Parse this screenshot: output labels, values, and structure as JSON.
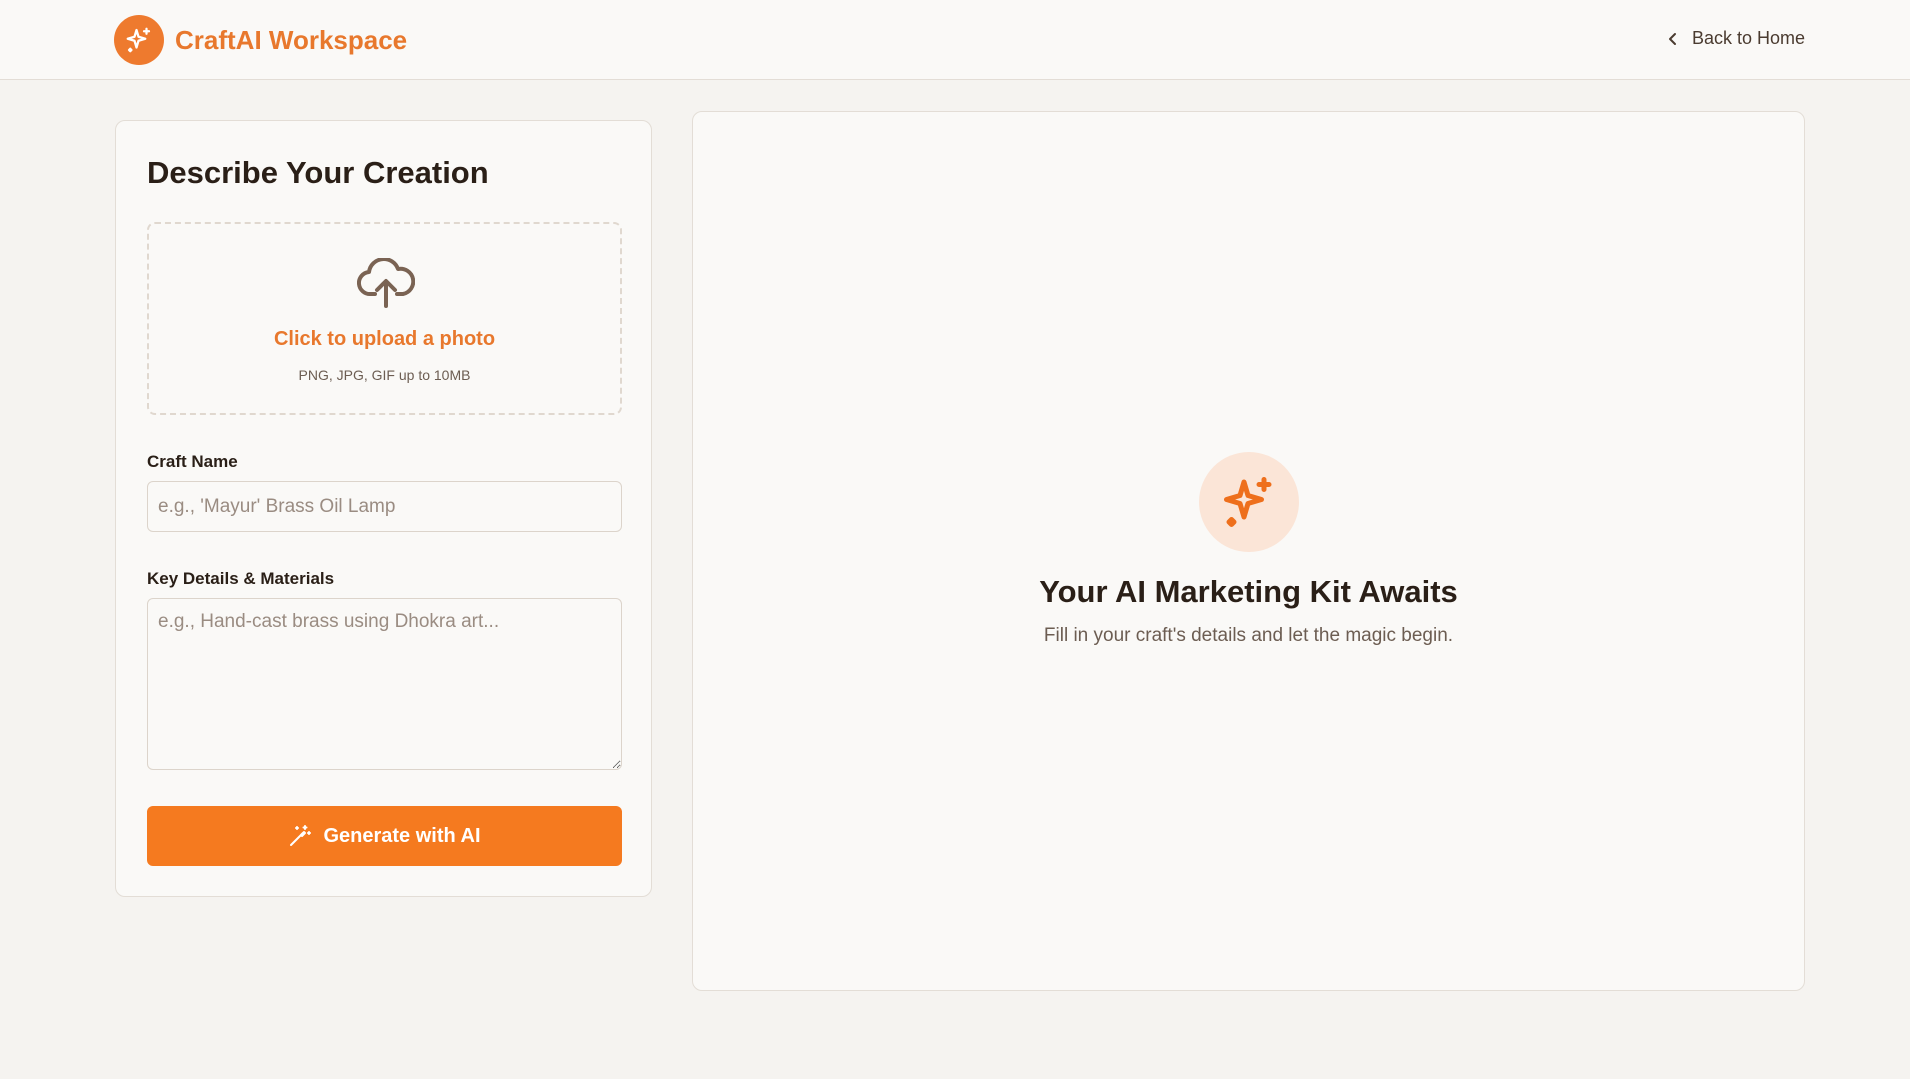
{
  "header": {
    "brand_title": "CraftAI Workspace",
    "back_link": "Back to Home",
    "logo_icon": "sparkles-icon"
  },
  "form": {
    "title": "Describe Your Creation",
    "upload": {
      "text": "Click to upload a photo",
      "hint": "PNG, JPG, GIF up to 10MB",
      "icon": "cloud-upload-icon"
    },
    "craft_name": {
      "label": "Craft Name",
      "placeholder": "e.g., 'Mayur' Brass Oil Lamp",
      "value": ""
    },
    "details": {
      "label": "Key Details & Materials",
      "placeholder": "e.g., Hand-cast brass using Dhokra art...",
      "value": ""
    },
    "generate_button": {
      "label": "Generate with AI",
      "icon": "magic-wand-icon"
    }
  },
  "result_panel": {
    "title": "Your AI Marketing Kit Awaits",
    "subtitle": "Fill in your craft's details and let the magic begin.",
    "icon": "sparkles-icon"
  },
  "colors": {
    "accent": "#f57a1f",
    "brand_text": "#e8782d",
    "background": "#f5f3f0",
    "card": "#faf9f7",
    "badge_bg": "#fbe5d7"
  }
}
